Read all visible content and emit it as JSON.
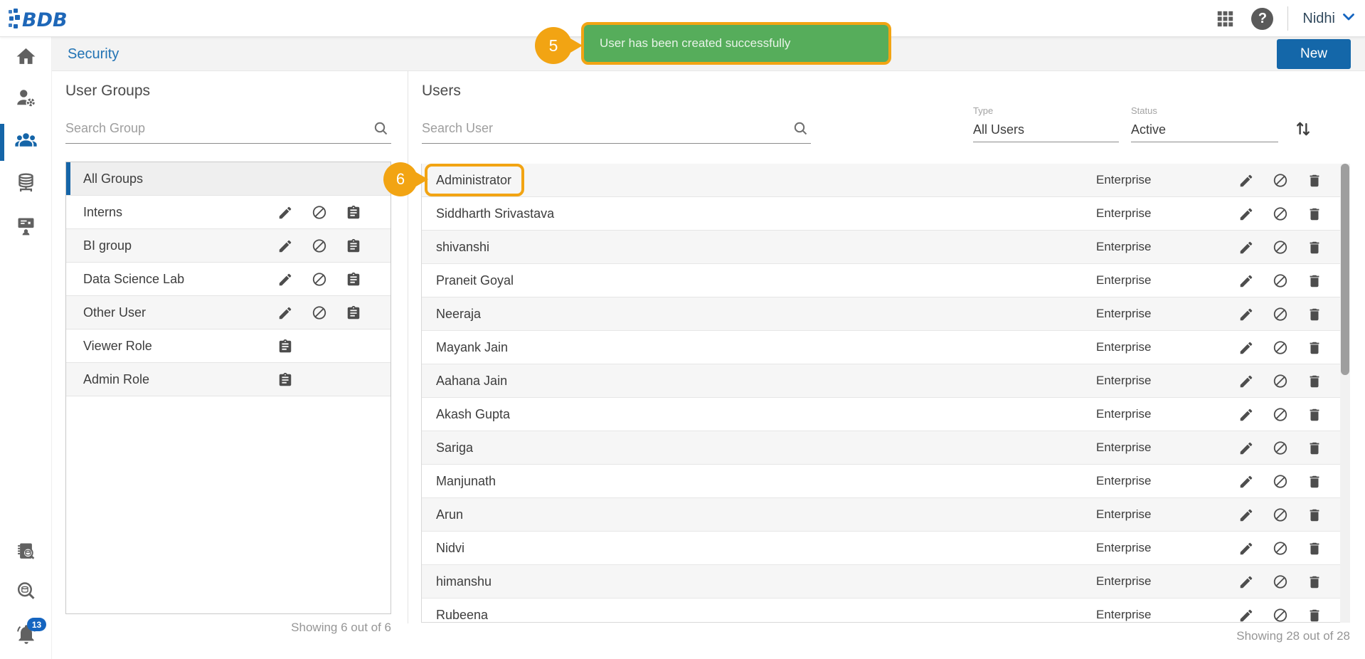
{
  "topbar": {
    "logo_text": "BDB",
    "user_name": "Nidhi"
  },
  "header": {
    "title": "Security",
    "new_button": "New"
  },
  "toast": {
    "message": "User has been created successfully",
    "callout_number": "5"
  },
  "annotations": {
    "user_callout_number": "6",
    "highlighted_user": "Administrator"
  },
  "sidebar": {
    "notification_count": "13"
  },
  "groups_panel": {
    "title": "User Groups",
    "search_placeholder": "Search Group",
    "footer": "Showing 6 out of 6",
    "items": [
      {
        "label": "All Groups",
        "selected": true,
        "actions": []
      },
      {
        "label": "Interns",
        "actions": [
          "edit",
          "block",
          "clipboard"
        ]
      },
      {
        "label": "BI group",
        "actions": [
          "edit",
          "block",
          "clipboard"
        ]
      },
      {
        "label": "Data Science Lab",
        "actions": [
          "edit",
          "block",
          "clipboard"
        ]
      },
      {
        "label": "Other User",
        "actions": [
          "edit",
          "block",
          "clipboard"
        ]
      },
      {
        "label": "Viewer Role",
        "actions": [
          "clipboard"
        ]
      },
      {
        "label": "Admin Role",
        "actions": [
          "clipboard"
        ]
      }
    ]
  },
  "users_panel": {
    "title": "Users",
    "search_placeholder": "Search User",
    "type_filter": {
      "label": "Type",
      "value": "All Users"
    },
    "status_filter": {
      "label": "Status",
      "value": "Active"
    },
    "footer": "Showing 28 out of 28",
    "row_type": "Enterprise",
    "row_actions": [
      "edit",
      "block",
      "delete"
    ],
    "users": [
      "Administrator",
      "Siddharth Srivastava",
      "shivanshi",
      "Praneit Goyal",
      "Neeraja",
      "Mayank Jain",
      "Aahana Jain",
      "Akash Gupta",
      "Sariga",
      "Manjunath",
      "Arun",
      "Nidvi",
      "himanshu",
      "Rubeena"
    ]
  },
  "colors": {
    "accent_blue": "#1565a8",
    "callout_orange": "#f2a413",
    "toast_green": "#56ad5b",
    "badge_blue": "#1565c0",
    "title_blue": "#2273b4"
  }
}
